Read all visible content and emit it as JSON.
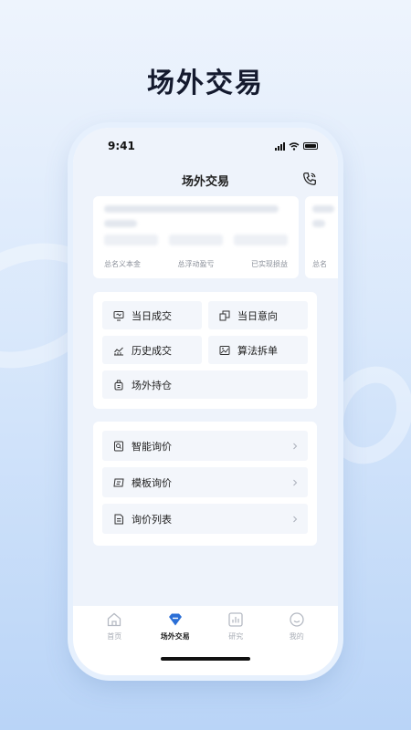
{
  "headline": "场外交易",
  "status": {
    "time": "9:41"
  },
  "nav": {
    "title": "场外交易"
  },
  "summary": {
    "labels": [
      "总名义本金",
      "总浮动盈亏",
      "已实现损益"
    ],
    "peek_label": "总名"
  },
  "menu": {
    "items": [
      {
        "label": "当日成交",
        "icon": "monitor-icon"
      },
      {
        "label": "当日意向",
        "icon": "copy-icon"
      },
      {
        "label": "历史成交",
        "icon": "chart-line-icon"
      },
      {
        "label": "算法拆单",
        "icon": "picture-icon"
      },
      {
        "label": "场外持仓",
        "icon": "bag-icon"
      }
    ]
  },
  "inquiry": {
    "items": [
      {
        "label": "智能询价",
        "icon": "search-doc-icon"
      },
      {
        "label": "模板询价",
        "icon": "template-icon"
      },
      {
        "label": "询价列表",
        "icon": "list-doc-icon"
      }
    ]
  },
  "tabbar": {
    "items": [
      {
        "label": "首页",
        "icon": "home-icon",
        "active": false
      },
      {
        "label": "场外交易",
        "icon": "diamond-icon",
        "active": true
      },
      {
        "label": "研究",
        "icon": "bar-chart-icon",
        "active": false
      },
      {
        "label": "我的",
        "icon": "smile-icon",
        "active": false
      }
    ]
  },
  "colors": {
    "accent": "#2b6fd6",
    "bg_top": "#eef4fd",
    "bg_bottom": "#b9d4f7"
  }
}
